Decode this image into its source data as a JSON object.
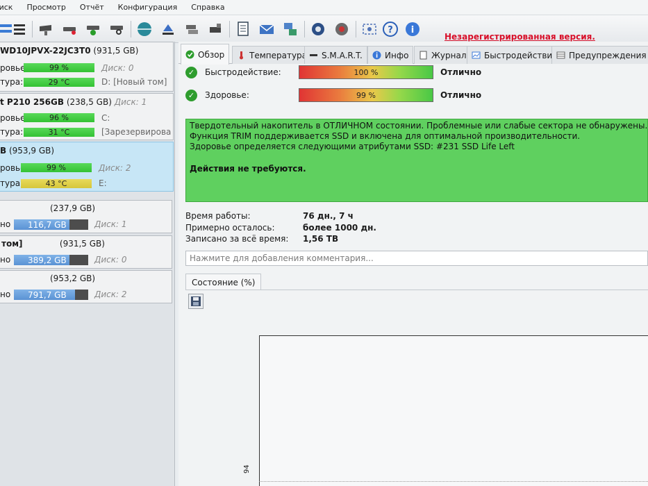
{
  "menu": [
    "Диск",
    "Просмотр",
    "Отчёт",
    "Конфигурация",
    "Справка"
  ],
  "unregistered": "Незарегистрированная версия.",
  "disks": [
    {
      "title_bold": "WD10JPVX-22JC3T0",
      "title_size": "(931,5 GB)",
      "health_label": "ровье:",
      "health_value": "99 %",
      "disk_label": "Диск: 0",
      "temp_label": "тура:",
      "temp_value": "29 °C",
      "volume": "D: [Новый том]"
    },
    {
      "title_bold": "t P210 256GB",
      "title_size": "(238,5 GB)",
      "title_disk": "Диск: 1",
      "health_label": "ровье:",
      "health_value": "96 %",
      "disk_label": "C:",
      "temp_label": "тура:",
      "temp_value": "31 °C",
      "volume": "[Зарезервирова"
    },
    {
      "title_bold": "B",
      "title_size": "(953,9 GB)",
      "health_label": "ровье:",
      "health_value": "99 %",
      "disk_label": "Диск: 2",
      "temp_label": "тура:",
      "temp_value": "43 °C",
      "volume": "E:"
    }
  ],
  "volumes": [
    {
      "title": "(237,9 GB)",
      "label": "но",
      "value": "116,7 GB",
      "fill": 0.5,
      "disk": "Диск: 1"
    },
    {
      "title": "том]",
      "title_size": "(931,5 GB)",
      "label": "но",
      "value": "389,2 GB",
      "fill": 0.42,
      "disk": "Диск: 0"
    },
    {
      "title": "(953,2 GB)",
      "label": "но",
      "value": "791,7 GB",
      "fill": 0.83,
      "disk": "Диск: 2"
    }
  ],
  "tabs": [
    "Обзор",
    "Температура",
    "S.M.A.R.T.",
    "Инфо",
    "Журнал",
    "Быстродействие",
    "Предупреждения"
  ],
  "performance": {
    "label": "Быстродействие:",
    "bar": "100 %",
    "value": "Отлично"
  },
  "health": {
    "label": "Здоровье:",
    "bar": "99 %",
    "value": "Отлично"
  },
  "message": {
    "line1": "Твердотельный накопитель в ОТЛИЧНОМ состоянии. Проблемные или слабые сектора не обнаружены.",
    "line2": "Функция TRIM поддерживается SSD и включена для оптимальной производительности.",
    "line3": "Здоровье определяется следующими атрибутами SSD: #231 SSD Life Left",
    "action": "Действия не требуются."
  },
  "stats": [
    {
      "label": "Время работы:",
      "value": "76 дн., 7 ч"
    },
    {
      "label": "Примерно осталось:",
      "value": "более 1000 дн."
    },
    {
      "label": "Записано за всё время:",
      "value": "1,56 TB"
    }
  ],
  "comment_placeholder": "Нажмите для добавления комментария...",
  "state_tab": "Состояние (%)",
  "chart_tick": "94"
}
